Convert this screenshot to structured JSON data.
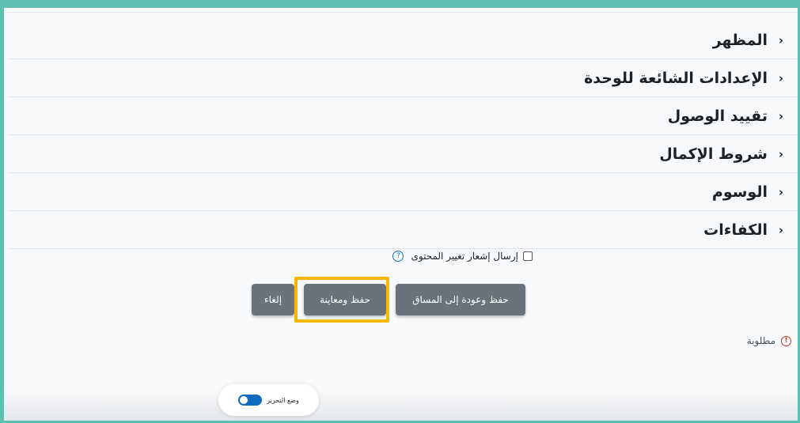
{
  "sections": [
    {
      "label": "المظهر"
    },
    {
      "label": "الإعدادات الشائعة للوحدة"
    },
    {
      "label": "تقييد الوصول"
    },
    {
      "label": "شروط الإكمال"
    },
    {
      "label": "الوسوم"
    },
    {
      "label": "الكفاءات"
    }
  ],
  "notify": {
    "label": "إرسال إشعار تغيير المحتوى",
    "checked": false,
    "help_icon": "question-circle-icon"
  },
  "buttons": {
    "save_return": "حفظ وعودة إلى المساق",
    "save_preview": "حفظ ومعاينة",
    "cancel": "إلغاء"
  },
  "required": {
    "label": "مطلوبة",
    "icon": "exclamation-circle-icon"
  },
  "edit_mode": {
    "label": "وضع التحرير",
    "enabled": true
  },
  "colors": {
    "frame_border": "#5fbfb1",
    "button_bg": "#6a737b",
    "highlight": "#f5b800",
    "toggle_on": "#0f6cbf",
    "required_icon": "#ca3120"
  }
}
